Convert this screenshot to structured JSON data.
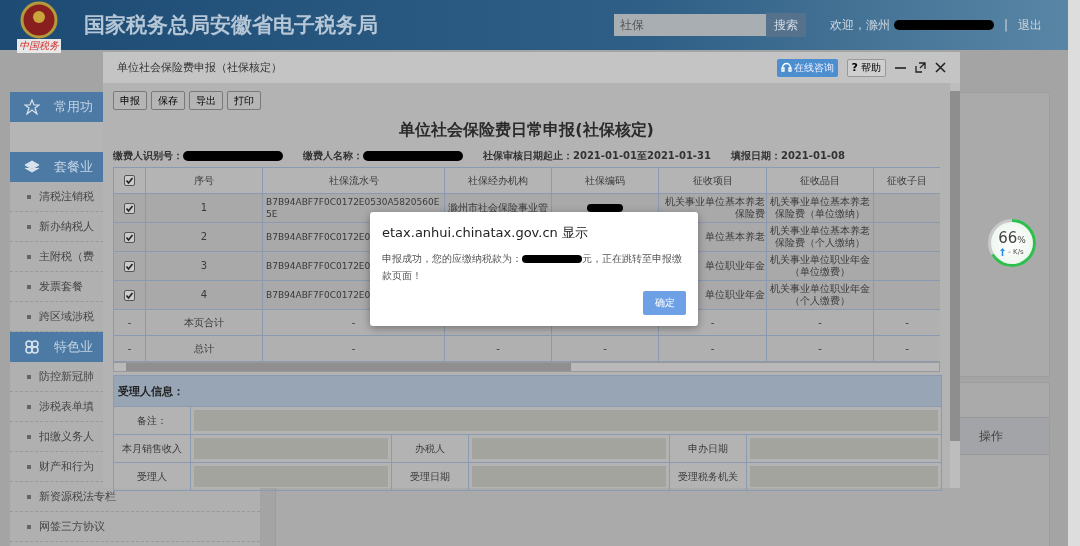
{
  "header": {
    "emblem_caption": "中国税务",
    "title": "国家税务总局安徽省电子税务局",
    "search": {
      "value": "社保",
      "button": "搜索"
    },
    "greeting": "欢迎，滁州",
    "separator": "|",
    "logout": "退出"
  },
  "sidebar": {
    "sections": [
      {
        "title": "常用功"
      },
      {
        "title": "套餐业",
        "items": [
          "清税注销税",
          "新办纳税人",
          "主附税（费",
          "发票套餐",
          "跨区域涉税"
        ]
      },
      {
        "title": "特色业",
        "items": [
          "防控新冠肺",
          "涉税表单填",
          "扣缴义务人",
          "财产和行为",
          "新资源税法专栏",
          "网签三方协议"
        ]
      }
    ]
  },
  "background_panel": {
    "column_header": "操作"
  },
  "speed_widget": {
    "level": 0.66,
    "percent": "66",
    "unit": "%",
    "speed": "- K/s"
  },
  "modal": {
    "title": "单位社会保险费申报（社保核定）",
    "consult_button": "在线咨询",
    "help_mark": "?",
    "help_button": "帮助",
    "toolbar": [
      "申报",
      "保存",
      "导出",
      "打印"
    ],
    "form_title": "单位社会保险费日常申报(社保核定)",
    "info": [
      {
        "text": "缴费人识别号：",
        "redacted": true
      },
      {
        "text": "缴费人名称：",
        "redacted": true
      },
      {
        "text": "社保审核日期起止：2021-01-01至2021-01-31",
        "redacted": false
      },
      {
        "text": "填报日期：2021-01-08",
        "redacted": false
      }
    ],
    "table": {
      "header_checked": true,
      "columns": [
        "序号",
        "社保流水号",
        "社保经办机构",
        "社保编码",
        "征收项目",
        "征收品目",
        "征收子目"
      ],
      "rows": [
        {
          "checked": true,
          "index": "1",
          "serial": "B7B94ABF7F0C0172E0530A5820560E5E",
          "agency": "滁州市社会保险事业管",
          "code_redacted": true,
          "item": "机关事业单位基本养老保险费",
          "subitem": "机关事业单位基本养老保险费（单位缴纳）"
        },
        {
          "checked": true,
          "index": "2",
          "serial": "B7B94ABF7F0C0172E0",
          "item": "单位基本养老",
          "subitem": "机关事业单位基本养老保险费（个人缴纳）"
        },
        {
          "checked": true,
          "index": "3",
          "serial": "B7B94ABF7F0C0172E0",
          "item": "单位职业年金",
          "subitem": "机关事业单位职业年金（单位缴费）"
        },
        {
          "checked": true,
          "index": "4",
          "serial": "B7B94ABF7F0C0172E0",
          "item": "单位职业年金",
          "subitem": "机关事业单位职业年金（个人缴费）"
        }
      ],
      "totals": [
        {
          "select": "-",
          "index": "本页合计",
          "serial": "-",
          "item": "-",
          "subitem": "-",
          "column_8": "-"
        },
        {
          "select": "-",
          "index": "总计",
          "serial": "-",
          "agency": "-",
          "code": "-",
          "item": "-",
          "subitem": "-",
          "column_8": "-"
        }
      ]
    },
    "handler": {
      "title": "受理人信息：",
      "remark_label": "备注：",
      "rows": [
        [
          "本月销售收入",
          "办税人",
          "申办日期"
        ],
        [
          "受理人",
          "受理日期",
          "受理税务机关"
        ]
      ]
    }
  },
  "alert": {
    "title": "etax.anhui.chinatax.gov.cn 显示",
    "message_before": "申报成功，您的应缴纳税款为：",
    "message_after": "元，正在跳转至申报缴款页面！",
    "button": "确定"
  }
}
